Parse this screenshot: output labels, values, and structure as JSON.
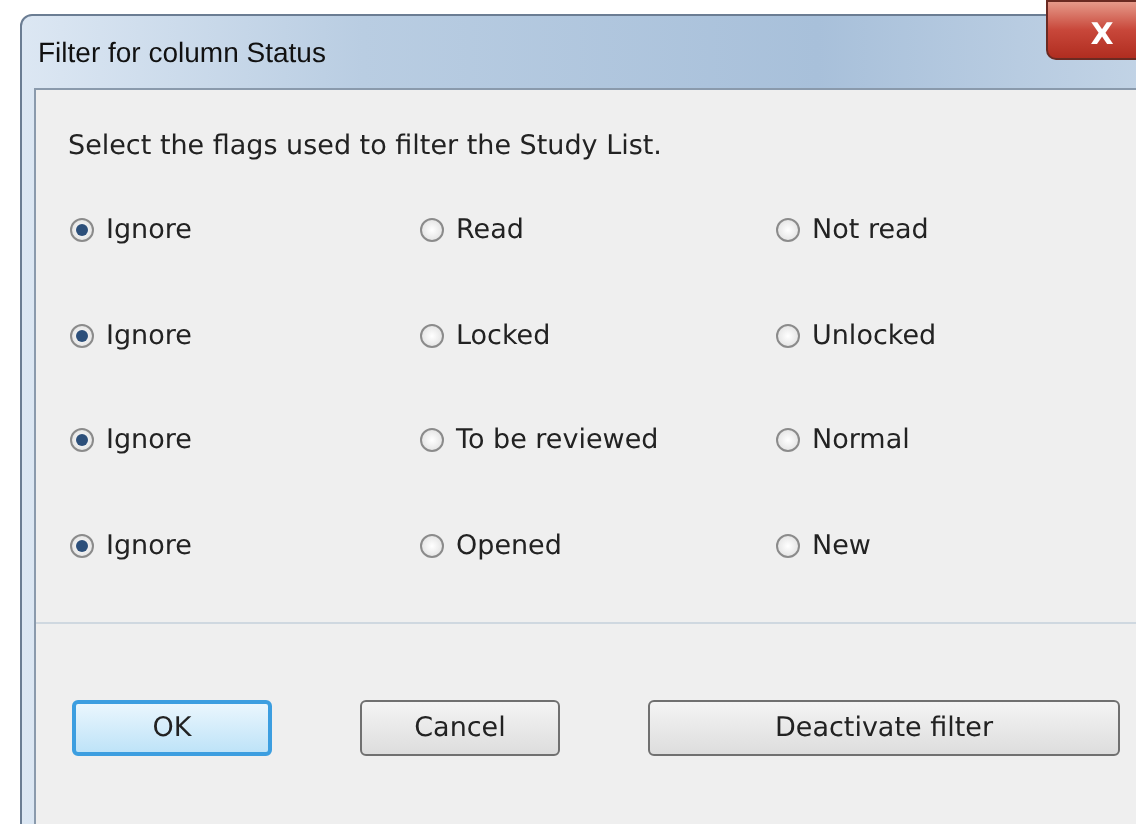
{
  "window": {
    "title": "Filter for column Status",
    "close_label": "X"
  },
  "instruction": "Select the flags used to filter the Study List.",
  "rows": [
    {
      "options": [
        {
          "label": "Ignore",
          "selected": true
        },
        {
          "label": "Read",
          "selected": false
        },
        {
          "label": "Not read",
          "selected": false
        }
      ]
    },
    {
      "options": [
        {
          "label": "Ignore",
          "selected": true
        },
        {
          "label": "Locked",
          "selected": false
        },
        {
          "label": "Unlocked",
          "selected": false
        }
      ]
    },
    {
      "options": [
        {
          "label": "Ignore",
          "selected": true
        },
        {
          "label": "To be reviewed",
          "selected": false
        },
        {
          "label": "Normal",
          "selected": false
        }
      ]
    },
    {
      "options": [
        {
          "label": "Ignore",
          "selected": true
        },
        {
          "label": "Opened",
          "selected": false
        },
        {
          "label": "New",
          "selected": false
        }
      ]
    }
  ],
  "buttons": [
    {
      "label": "OK",
      "kind": "default"
    },
    {
      "label": "Cancel",
      "kind": "normal"
    },
    {
      "label": "Deactivate filter",
      "kind": "wide"
    }
  ]
}
